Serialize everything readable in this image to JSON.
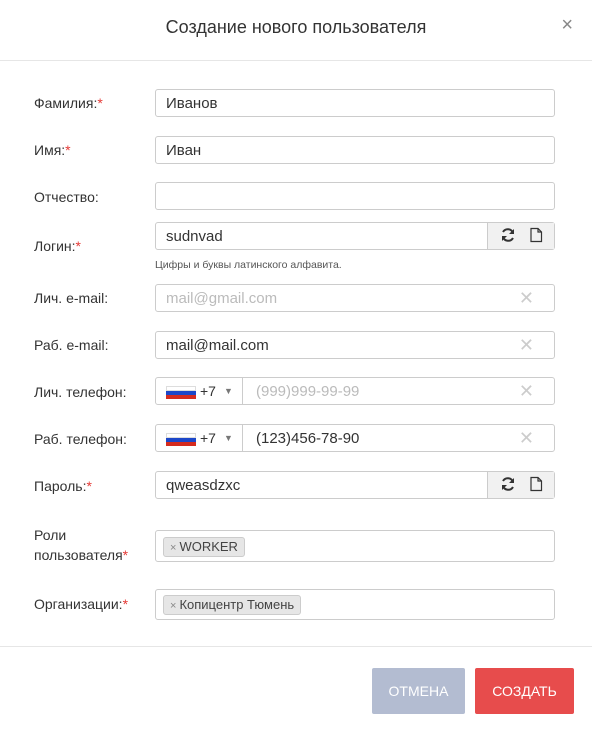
{
  "dialog": {
    "title": "Создание нового пользователя",
    "close": "×"
  },
  "fields": {
    "surname": {
      "label": "Фамилия:",
      "value": "Иванов"
    },
    "name": {
      "label": "Имя:",
      "value": "Иван"
    },
    "patronymic": {
      "label": "Отчество:",
      "value": ""
    },
    "login": {
      "label": "Логин:",
      "value": "sudnvad",
      "hint": "Цифры и буквы латинского алфавита."
    },
    "personal_email": {
      "label": "Лич. e-mail:",
      "placeholder": "mail@gmail.com"
    },
    "work_email": {
      "label": "Раб. e-mail:",
      "value": "mail@mail.com"
    },
    "personal_phone": {
      "label": "Лич. телефон:",
      "country_code": "+7",
      "placeholder": "(999)999-99-99"
    },
    "work_phone": {
      "label": "Раб. телефон:",
      "country_code": "+7",
      "value": "(123)456-78-90"
    },
    "password": {
      "label": "Пароль:",
      "value": "qweasdzxc"
    },
    "roles": {
      "label_line1": "Роли",
      "label_line2": "пользователя",
      "chip": "WORKER"
    },
    "organizations": {
      "label": "Организации:",
      "chip": "Копицентр Тюмень"
    }
  },
  "required_mark": "*",
  "clear_symbol": "✕",
  "chip_remove": "×",
  "caret": "▼",
  "buttons": {
    "cancel": "Отмена",
    "create": "Создать"
  },
  "colors": {
    "required": "#e53935",
    "cancel_bg": "#b3bcd1",
    "create_bg": "#e74c4c"
  },
  "icons": {
    "refresh": "refresh-icon",
    "copy": "document-icon",
    "flag": "russia-flag-icon"
  }
}
